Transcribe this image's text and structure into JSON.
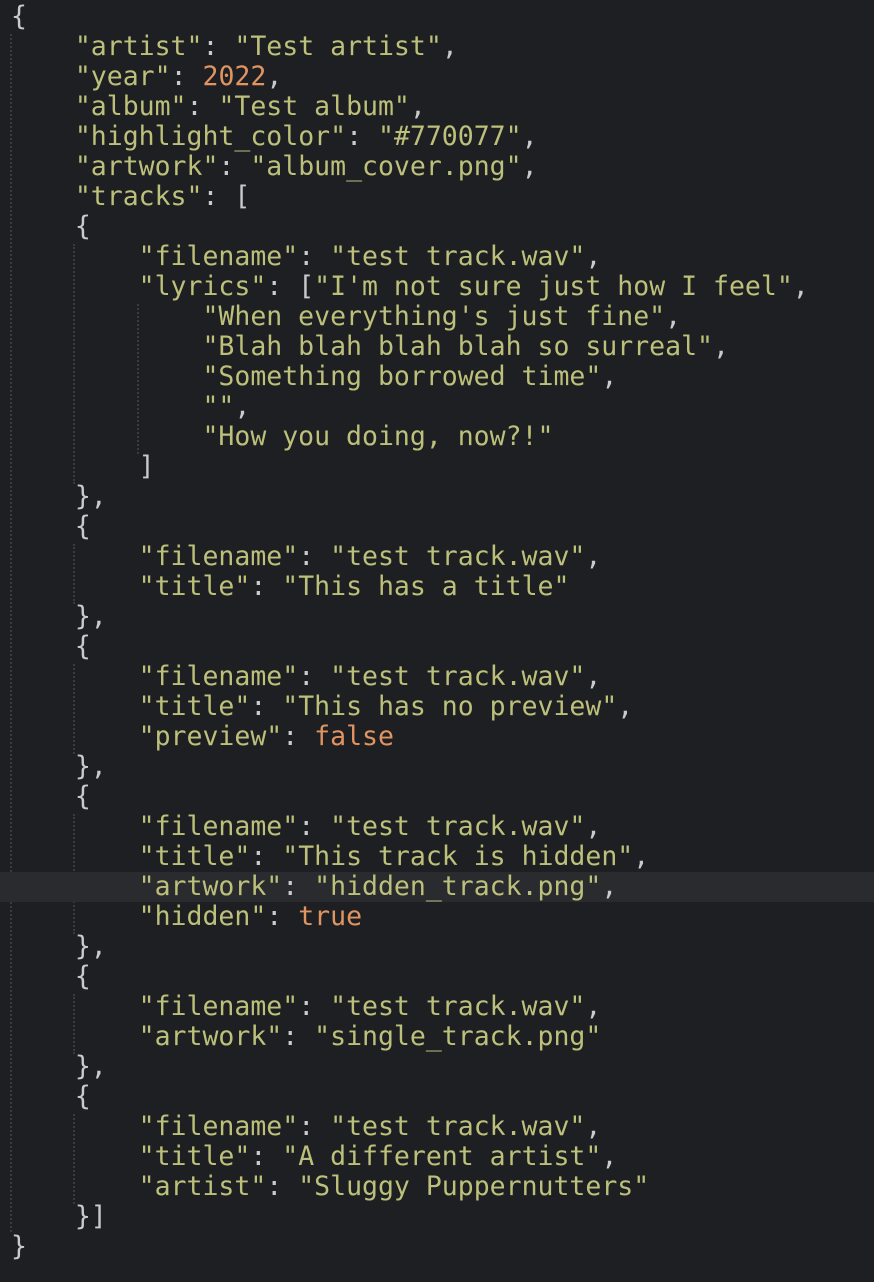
{
  "editor": {
    "language": "json",
    "current_line": 30,
    "colors": {
      "background": "#1e1f22",
      "string": "#bcc07a",
      "literal": "#e09462",
      "punctuation": "#c9cacc",
      "current_line": "#2a2b2f"
    },
    "lines": [
      [
        [
          "p",
          "{"
        ]
      ],
      [
        [
          "p",
          "    "
        ],
        [
          "s",
          "\"artist\""
        ],
        [
          "p",
          ": "
        ],
        [
          "s",
          "\"Test artist\""
        ],
        [
          "p",
          ","
        ]
      ],
      [
        [
          "p",
          "    "
        ],
        [
          "s",
          "\"year\""
        ],
        [
          "p",
          ": "
        ],
        [
          "n",
          "2022"
        ],
        [
          "p",
          ","
        ]
      ],
      [
        [
          "p",
          "    "
        ],
        [
          "s",
          "\"album\""
        ],
        [
          "p",
          ": "
        ],
        [
          "s",
          "\"Test album\""
        ],
        [
          "p",
          ","
        ]
      ],
      [
        [
          "p",
          "    "
        ],
        [
          "s",
          "\"highlight_color\""
        ],
        [
          "p",
          ": "
        ],
        [
          "s",
          "\"#770077\""
        ],
        [
          "p",
          ","
        ]
      ],
      [
        [
          "p",
          "    "
        ],
        [
          "s",
          "\"artwork\""
        ],
        [
          "p",
          ": "
        ],
        [
          "s",
          "\"album_cover.png\""
        ],
        [
          "p",
          ","
        ]
      ],
      [
        [
          "p",
          "    "
        ],
        [
          "s",
          "\"tracks\""
        ],
        [
          "p",
          ": ["
        ]
      ],
      [
        [
          "p",
          "    {"
        ]
      ],
      [
        [
          "p",
          "        "
        ],
        [
          "s",
          "\"filename\""
        ],
        [
          "p",
          ": "
        ],
        [
          "s",
          "\"test track.wav\""
        ],
        [
          "p",
          ","
        ]
      ],
      [
        [
          "p",
          "        "
        ],
        [
          "s",
          "\"lyrics\""
        ],
        [
          "p",
          ": ["
        ],
        [
          "s",
          "\"I'm not sure just how I feel\""
        ],
        [
          "p",
          ","
        ]
      ],
      [
        [
          "p",
          "            "
        ],
        [
          "s",
          "\"When everything's just fine\""
        ],
        [
          "p",
          ","
        ]
      ],
      [
        [
          "p",
          "            "
        ],
        [
          "s",
          "\"Blah blah blah blah so surreal\""
        ],
        [
          "p",
          ","
        ]
      ],
      [
        [
          "p",
          "            "
        ],
        [
          "s",
          "\"Something borrowed time\""
        ],
        [
          "p",
          ","
        ]
      ],
      [
        [
          "p",
          "            "
        ],
        [
          "s",
          "\"\""
        ],
        [
          "p",
          ","
        ]
      ],
      [
        [
          "p",
          "            "
        ],
        [
          "s",
          "\"How you doing, now?!\""
        ]
      ],
      [
        [
          "p",
          "        ]"
        ]
      ],
      [
        [
          "p",
          "    },"
        ]
      ],
      [
        [
          "p",
          "    {"
        ]
      ],
      [
        [
          "p",
          "        "
        ],
        [
          "s",
          "\"filename\""
        ],
        [
          "p",
          ": "
        ],
        [
          "s",
          "\"test track.wav\""
        ],
        [
          "p",
          ","
        ]
      ],
      [
        [
          "p",
          "        "
        ],
        [
          "s",
          "\"title\""
        ],
        [
          "p",
          ": "
        ],
        [
          "s",
          "\"This has a title\""
        ]
      ],
      [
        [
          "p",
          "    },"
        ]
      ],
      [
        [
          "p",
          "    {"
        ]
      ],
      [
        [
          "p",
          "        "
        ],
        [
          "s",
          "\"filename\""
        ],
        [
          "p",
          ": "
        ],
        [
          "s",
          "\"test track.wav\""
        ],
        [
          "p",
          ","
        ]
      ],
      [
        [
          "p",
          "        "
        ],
        [
          "s",
          "\"title\""
        ],
        [
          "p",
          ": "
        ],
        [
          "s",
          "\"This has no preview\""
        ],
        [
          "p",
          ","
        ]
      ],
      [
        [
          "p",
          "        "
        ],
        [
          "s",
          "\"preview\""
        ],
        [
          "p",
          ": "
        ],
        [
          "n",
          "false"
        ]
      ],
      [
        [
          "p",
          "    },"
        ]
      ],
      [
        [
          "p",
          "    {"
        ]
      ],
      [
        [
          "p",
          "        "
        ],
        [
          "s",
          "\"filename\""
        ],
        [
          "p",
          ": "
        ],
        [
          "s",
          "\"test track.wav\""
        ],
        [
          "p",
          ","
        ]
      ],
      [
        [
          "p",
          "        "
        ],
        [
          "s",
          "\"title\""
        ],
        [
          "p",
          ": "
        ],
        [
          "s",
          "\"This track is hidden\""
        ],
        [
          "p",
          ","
        ]
      ],
      [
        [
          "p",
          "        "
        ],
        [
          "s",
          "\"artwork\""
        ],
        [
          "p",
          ": "
        ],
        [
          "s",
          "\"hidden_track.png\""
        ],
        [
          "p",
          ","
        ]
      ],
      [
        [
          "p",
          "        "
        ],
        [
          "s",
          "\"hidden\""
        ],
        [
          "p",
          ": "
        ],
        [
          "n",
          "true"
        ]
      ],
      [
        [
          "p",
          "    },"
        ]
      ],
      [
        [
          "p",
          "    {"
        ]
      ],
      [
        [
          "p",
          "        "
        ],
        [
          "s",
          "\"filename\""
        ],
        [
          "p",
          ": "
        ],
        [
          "s",
          "\"test track.wav\""
        ],
        [
          "p",
          ","
        ]
      ],
      [
        [
          "p",
          "        "
        ],
        [
          "s",
          "\"artwork\""
        ],
        [
          "p",
          ": "
        ],
        [
          "s",
          "\"single_track.png\""
        ]
      ],
      [
        [
          "p",
          "    },"
        ]
      ],
      [
        [
          "p",
          "    {"
        ]
      ],
      [
        [
          "p",
          "        "
        ],
        [
          "s",
          "\"filename\""
        ],
        [
          "p",
          ": "
        ],
        [
          "s",
          "\"test track.wav\""
        ],
        [
          "p",
          ","
        ]
      ],
      [
        [
          "p",
          "        "
        ],
        [
          "s",
          "\"title\""
        ],
        [
          "p",
          ": "
        ],
        [
          "s",
          "\"A different artist\""
        ],
        [
          "p",
          ","
        ]
      ],
      [
        [
          "p",
          "        "
        ],
        [
          "s",
          "\"artist\""
        ],
        [
          "p",
          ": "
        ],
        [
          "s",
          "\"Sluggy Puppernutters\""
        ]
      ],
      [
        [
          "p",
          "    }]"
        ]
      ],
      [
        [
          "p",
          "}"
        ]
      ]
    ]
  }
}
